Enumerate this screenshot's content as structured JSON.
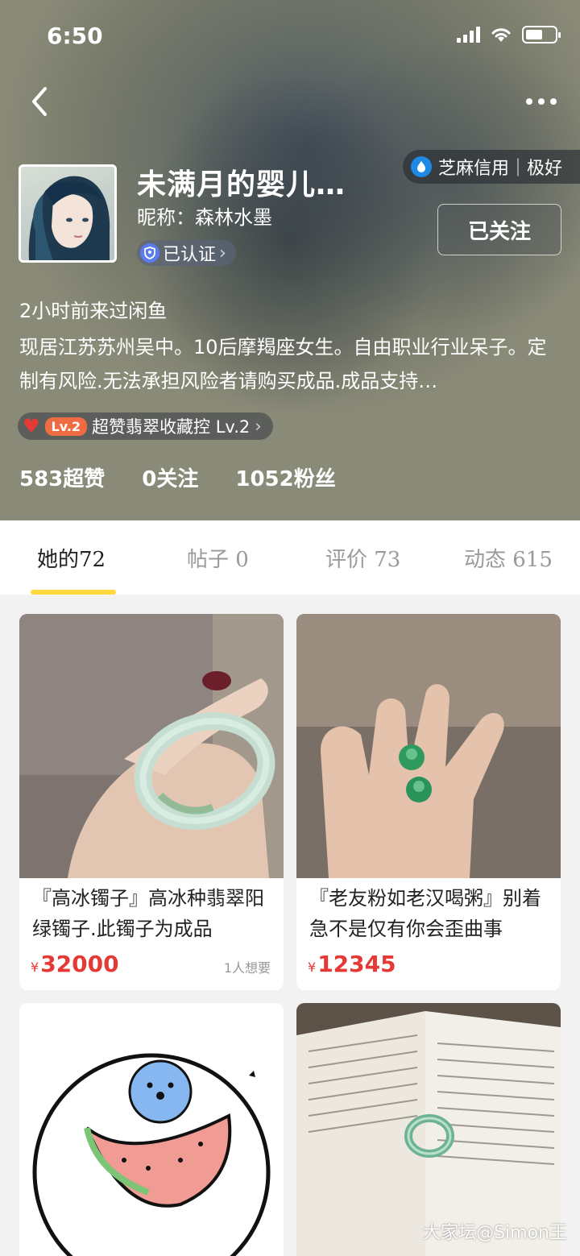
{
  "status": {
    "time": "6:50"
  },
  "profile": {
    "name": "未满月的婴儿…",
    "nickname": "昵称：森林水墨",
    "verified_label": "已认证",
    "credit_label": "芝麻信用｜极好",
    "follow_label": "已关注",
    "last_seen": "2小时前来过闲鱼",
    "bio": "现居江苏苏州吴中。10后摩羯座女生。自由职业行业呆子。定制有风险.无法承担风险者请购买成品.成品支持…",
    "level_badge": "Lv.2",
    "level_label": "超赞翡翠收藏控 Lv.2",
    "stats": {
      "likes": "583超赞",
      "following": "0关注",
      "fans": "1052粉丝"
    }
  },
  "tabs": [
    {
      "label": "她的72"
    },
    {
      "label": "帖子 0"
    },
    {
      "label": "评价 73"
    },
    {
      "label": "动态 615"
    }
  ],
  "items": [
    {
      "title": "『高冰镯子』高冰种翡翠阳绿镯子.此镯子为成品",
      "currency": "¥",
      "price": "32000",
      "want": "1人想要"
    },
    {
      "title": "『老友粉如老汉喝粥』别着急不是仅有你会歪曲事",
      "currency": "¥",
      "price": "12345",
      "want": ""
    },
    {
      "title": "",
      "currency": "",
      "price": "",
      "want": ""
    },
    {
      "title": "",
      "currency": "",
      "price": "",
      "want": ""
    }
  ],
  "watermark": "大家坛@Simon王",
  "colors": {
    "accent_yellow": "#ffd83d",
    "price_red": "#e53935",
    "verified_blue": "#5b7cf0"
  }
}
